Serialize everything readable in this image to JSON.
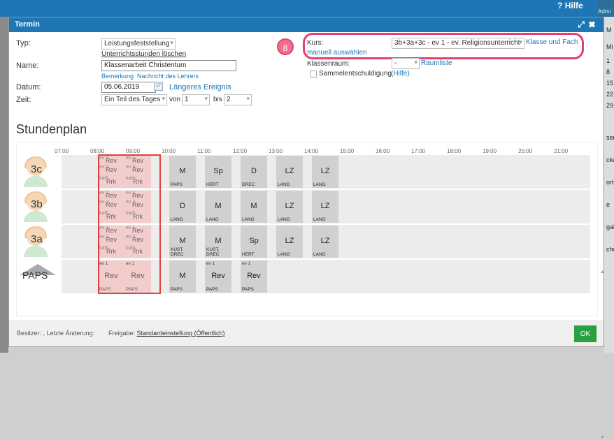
{
  "topbar": {
    "help_label": "Hilfe",
    "help_icon": "question-icon",
    "admin_label": "Admi"
  },
  "bg_right": [
    "M",
    "Mi",
    "1",
    "8",
    "15",
    "22",
    "29",
    "ser",
    "cke",
    "ort",
    "e",
    "gal",
    "che"
  ],
  "dialog": {
    "title": "Termin",
    "typ_label": "Typ:",
    "typ_value": "Leistungsfeststellung",
    "unterricht_loeschen": "Unterrichtsstunden löschen",
    "name_label": "Name:",
    "name_value": "Klassenarbeit Christentum",
    "bemerkung_link": "Bemerkung",
    "nachricht_link": "Nachricht des Lehrers",
    "datum_label": "Datum:",
    "datum_value": "05.06.2019",
    "laengeres_link": "Längeres Ereignis",
    "zeit_label": "Zeit:",
    "zeit_value": "Ein Teil des Tages",
    "von_label": "von",
    "von_value": "1",
    "bis_label": "bis",
    "bis_value": "2",
    "kurs_label": "Kurs:",
    "kurs_value": "3b+3a+3c - ev 1 - ev. Religionsunterricht",
    "klasse_fach_link": "Klasse und Fach",
    "manuell_link": "manuell auswählen",
    "klassenraum_label": "Klassenraum:",
    "klassenraum_value": "-",
    "raumliste_link": "Raumliste",
    "sammel_label": "Sammelentschuldigung",
    "hilfe_link": "(Hilfe)",
    "callout_number": "8"
  },
  "schedule": {
    "title": "Stundenplan",
    "times": [
      "07:00",
      "08:00",
      "09:00",
      "10:00",
      "11:00",
      "12:00",
      "13:00",
      "14:00",
      "15:00",
      "16:00",
      "17:00",
      "18:00",
      "19:00",
      "20:00",
      "21:00"
    ],
    "rows": [
      {
        "name": "3c",
        "cells": [
          {
            "subject": "M",
            "teacher": "PAPS"
          },
          {
            "subject": "Sp",
            "teacher": "HERT"
          },
          {
            "subject": "D",
            "teacher": "DREC"
          },
          {
            "subject": "LZ",
            "teacher": "LANG"
          },
          {
            "subject": "LZ",
            "teacher": "LANG"
          }
        ]
      },
      {
        "name": "3b",
        "cells": [
          {
            "subject": "D",
            "teacher": "LANG"
          },
          {
            "subject": "M",
            "teacher": "LANG"
          },
          {
            "subject": "M",
            "teacher": "LANG"
          },
          {
            "subject": "LZ",
            "teacher": "LANG"
          },
          {
            "subject": "LZ",
            "teacher": "LANG"
          }
        ]
      },
      {
        "name": "3a",
        "cells": [
          {
            "subject": "M",
            "teacher": "KUST, DREC"
          },
          {
            "subject": "M",
            "teacher": "KUST, DREC"
          },
          {
            "subject": "Sp",
            "teacher": "HERT"
          },
          {
            "subject": "LZ",
            "teacher": "LANG"
          },
          {
            "subject": "LZ",
            "teacher": "LANG"
          }
        ]
      },
      {
        "name": "PAPS",
        "cells": [
          {
            "subject": "M",
            "teacher": "PAPS",
            "group": ""
          },
          {
            "subject": "Rev",
            "teacher": "PAPS",
            "group": "ev 1"
          },
          {
            "subject": "Rev",
            "teacher": "PAPS",
            "group": "ev 1"
          }
        ]
      }
    ],
    "red_paps": [
      {
        "group": "ev 1",
        "subject": "Rev",
        "teacher": "PAPS"
      },
      {
        "group": "ev 1",
        "subject": "Rev",
        "teacher": "PAPS"
      }
    ],
    "red_stack_lines": [
      "ev 1",
      "Rev",
      "ev 2",
      "Rev",
      "kath.",
      "Rrk"
    ]
  },
  "footer": {
    "besitzer": "Besitzer: , Letzte Änderung:",
    "freigabe_label": "Freigabe:",
    "freigabe_value": "Standardeinstellung (Öffentlich)",
    "ok_label": "OK"
  },
  "colors": {
    "accent": "#1e76b4",
    "highlight": "#e3416d",
    "ok": "#2aa040",
    "red_block": "#f3cccc"
  }
}
